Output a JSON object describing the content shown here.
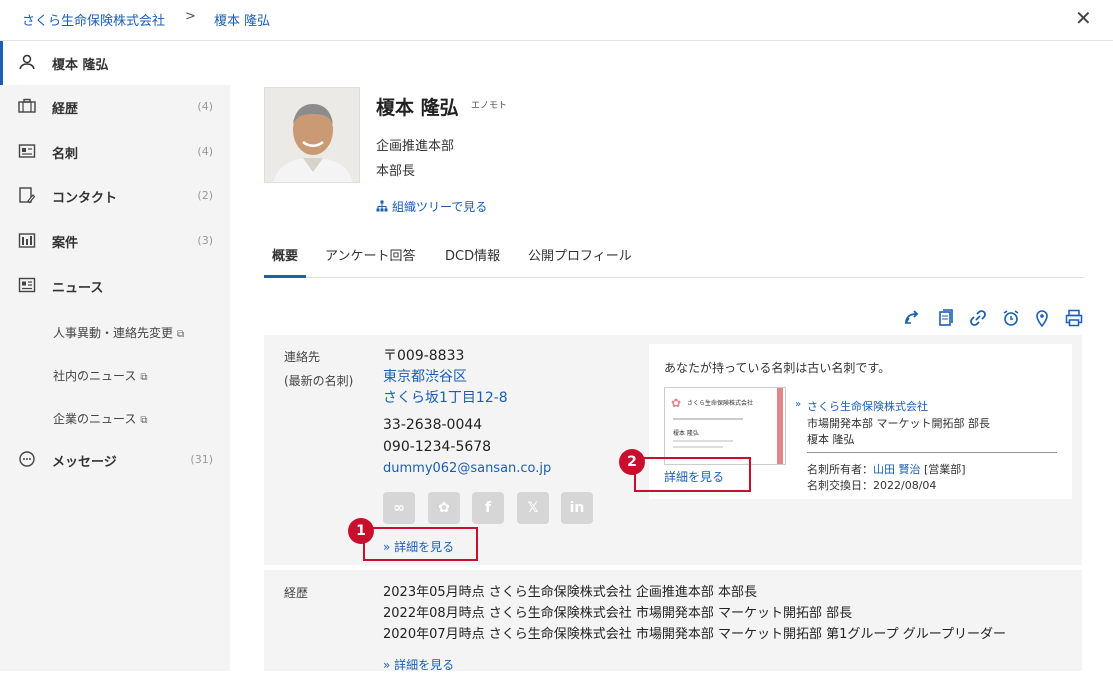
{
  "breadcrumb": {
    "company": "さくら生命保険株式会社",
    "separator": ">",
    "person": "榎本 隆弘",
    "close": "✕"
  },
  "sidebar": {
    "items": [
      {
        "label": "榎本 隆弘",
        "count": "",
        "icon": "person-icon"
      },
      {
        "label": "経歴",
        "count": "(4)",
        "icon": "briefcase-icon"
      },
      {
        "label": "名刺",
        "count": "(4)",
        "icon": "business-card-icon"
      },
      {
        "label": "コンタクト",
        "count": "(2)",
        "icon": "contact-icon"
      },
      {
        "label": "案件",
        "count": "(3)",
        "icon": "deal-icon"
      },
      {
        "label": "ニュース",
        "count": "",
        "icon": "news-icon"
      },
      {
        "label": "メッセージ",
        "count": "(31)",
        "icon": "message-icon"
      }
    ],
    "news_sub": [
      "人事異動・連絡先変更",
      "社内のニュース",
      "企業のニュース"
    ]
  },
  "profile": {
    "name": "榎本 隆弘",
    "kana": "エノモト",
    "department": "企画推進本部",
    "title": "本部長",
    "org_tree_link": "組織ツリーで見る"
  },
  "tabs": [
    "概要",
    "アンケート回答",
    "DCD情報",
    "公開プロフィール"
  ],
  "tools": [
    "sync-icon",
    "copy-icon",
    "link-icon",
    "alarm-icon",
    "map-pin-icon",
    "print-icon"
  ],
  "contact": {
    "label": "連絡先",
    "sublabel": "(最新の名刺)",
    "postal": "〒009-8833",
    "address1": "東京都渋谷区",
    "address2": "さくら坂1丁目12-8",
    "phone": "33-2638-0044",
    "mobile": "090-1234-5678",
    "email": "dummy062@sansan.co.jp",
    "social": [
      "eight-icon",
      "sansan-icon",
      "facebook-icon",
      "x-icon",
      "linkedin-icon"
    ],
    "more": "» 詳細を見る"
  },
  "card": {
    "note": "あなたが持っている名刺は古い名刺です。",
    "company": "さくら生命保険株式会社",
    "dept": "市場開発本部 マーケット開拓部 部長",
    "name": "榎本 隆弘",
    "owner_label": "名刺所有者：",
    "owner_name": "山田 賢治",
    "owner_dept": "[営業部]",
    "exchange": "名刺交換日：2022/08/04",
    "more": "詳細を見る",
    "img_company": "さくら生命保険株式会社",
    "img_name": "榎本 隆弘"
  },
  "callouts": {
    "one": "1",
    "two": "2"
  },
  "history": {
    "label": "経歴",
    "rows": [
      "2023年05月時点 さくら生命保険株式会社 企画推進本部 本部長",
      "2022年08月時点 さくら生命保険株式会社 市場開発本部 マーケット開拓部 部長",
      "2020年07月時点 さくら生命保険株式会社 市場開発本部 マーケット開拓部 第1グループ グループリーダー"
    ],
    "more": "» 詳細を見る"
  },
  "colors": {
    "accent": "#1a5fb4",
    "callout": "#c8102e",
    "sidebar_bg": "#f4f4f4"
  }
}
